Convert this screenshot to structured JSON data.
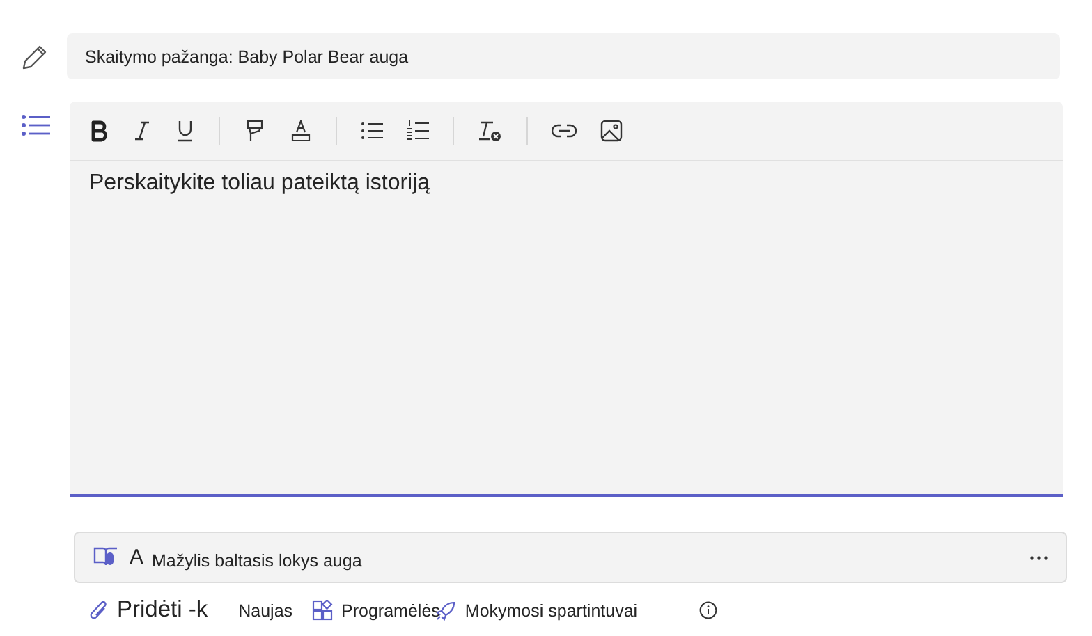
{
  "title_field": {
    "value": "Skaitymo pažanga: Baby Polar Bear auga"
  },
  "editor": {
    "body": "Perskaitykite toliau pateiktą istoriją",
    "focused": true
  },
  "attachment": {
    "prefix": "A",
    "name": "Mažylis baltasis lokys auga"
  },
  "actions": [
    {
      "kind": "attach",
      "label": "Pridėti -k"
    },
    {
      "kind": "plain",
      "label": "Naujas"
    },
    {
      "kind": "apps",
      "label": "Programėlės"
    },
    {
      "kind": "rocket",
      "label": "Mokymosi spartintuvai"
    },
    {
      "kind": "info"
    }
  ]
}
